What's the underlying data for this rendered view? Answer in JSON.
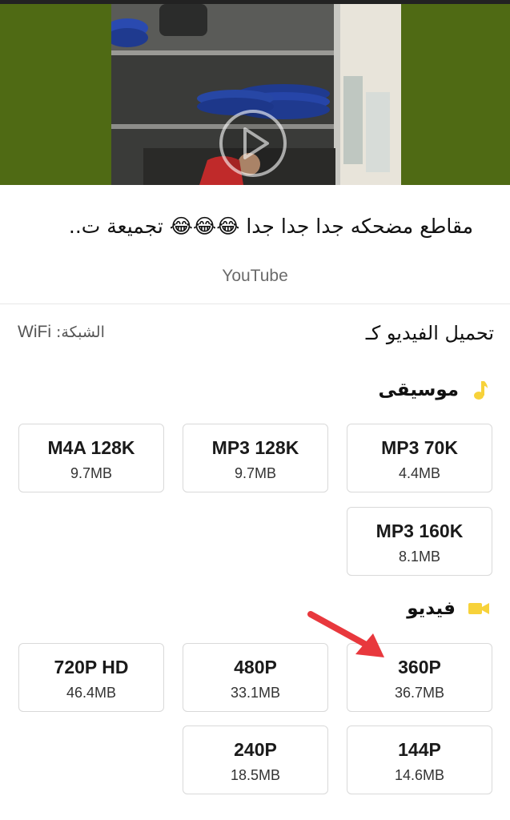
{
  "video": {
    "title": "مقاطع مضحكه جدا جدا جدا 😂😂😂 تجميعة ت..",
    "source": "YouTube"
  },
  "download": {
    "heading": "تحميل الفيديو كـ",
    "network_label": "الشبكة:",
    "network_value": "WiFi"
  },
  "music": {
    "label": "موسيقى",
    "icon": "music-note-icon",
    "options": [
      {
        "quality": "MP3 70K",
        "size": "4.4MB"
      },
      {
        "quality": "MP3 128K",
        "size": "9.7MB"
      },
      {
        "quality": "M4A 128K",
        "size": "9.7MB"
      },
      {
        "quality": "MP3 160K",
        "size": "8.1MB"
      }
    ]
  },
  "video_section": {
    "label": "فيديو",
    "icon": "video-camera-icon",
    "options": [
      {
        "quality": "360P",
        "size": "36.7MB"
      },
      {
        "quality": "480P",
        "size": "33.1MB"
      },
      {
        "quality": "720P HD",
        "size": "46.4MB"
      },
      {
        "quality": "144P",
        "size": "14.6MB"
      },
      {
        "quality": "240P",
        "size": "18.5MB"
      }
    ]
  },
  "colors": {
    "accent": "#f7d23a",
    "arrow": "#e8383d",
    "video_bg": "#4f6a14"
  }
}
